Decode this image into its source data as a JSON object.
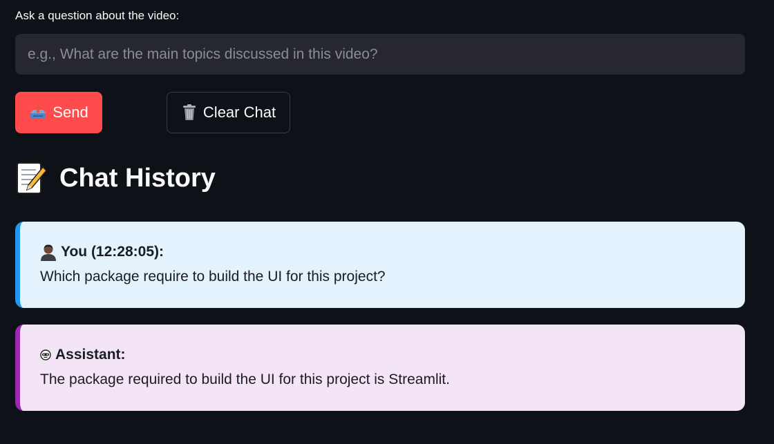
{
  "input": {
    "label": "Ask a question about the video:",
    "placeholder": "e.g., What are the main topics discussed in this video?",
    "value": ""
  },
  "buttons": {
    "send": {
      "label": "Send",
      "icon": "outbox-tray-icon"
    },
    "clear": {
      "label": "Clear Chat",
      "icon": "trash-can-icon"
    }
  },
  "history": {
    "title": "Chat History",
    "icon": "memo-icon"
  },
  "messages": [
    {
      "role": "user",
      "author": "You (12:28:05):",
      "icon": "person-icon",
      "text": "Which package require to build the UI for this project?"
    },
    {
      "role": "assistant",
      "author": "Assistant:",
      "icon": "robot-icon",
      "text": "The package required to build the UI for this project is Streamlit."
    }
  ],
  "colors": {
    "background": "#0e1117",
    "input_bg": "#262730",
    "send_button": "#ff4b4b",
    "user_bubble": "#e3f2fd",
    "user_accent": "#2196f3",
    "assistant_bubble": "#f3e5f5",
    "assistant_accent": "#9c27b0"
  }
}
